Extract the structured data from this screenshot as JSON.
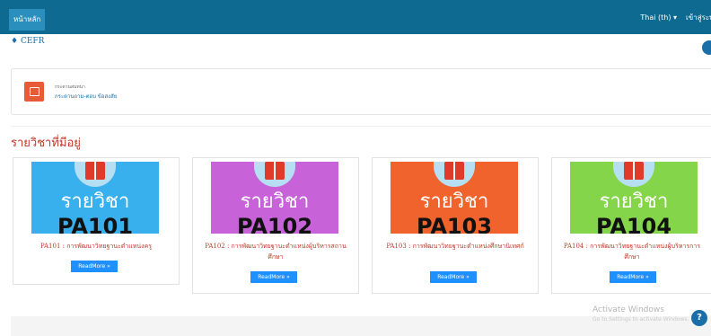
{
  "topbar": {
    "home_label": "หน้าหลัก",
    "language": "Thai (th) ▾",
    "login": "เข้าสู่ระบบ"
  },
  "site": {
    "cefr_label": "CEFR"
  },
  "category": {
    "label": "กระดานสนทนา",
    "link": "กระดานถาม-ตอบ ข้อสงสัย"
  },
  "section_title": "รายวิชาที่มีอยู่",
  "courses": [
    {
      "thumb_top": "รายวิชา",
      "thumb_code": "PA101",
      "title": "PA101 : การพัฒนาวิทยฐานะตำแหน่งครู",
      "button": "ReadMore »",
      "color": "#39b0ee"
    },
    {
      "thumb_top": "รายวิชา",
      "thumb_code": "PA102",
      "title": "PA102 : การพัฒนาวิทยฐานะตำแหน่งผู้บริหารสถานศึกษา",
      "button": "ReadMore »",
      "color": "#c862d8"
    },
    {
      "thumb_top": "รายวิชา",
      "thumb_code": "PA103",
      "title": "PA103 : การพัฒนาวิทยฐานะตำแหน่งศึกษานิเทศก์",
      "button": "ReadMore »",
      "color": "#f0632c"
    },
    {
      "thumb_top": "รายวิชา",
      "thumb_code": "PA104",
      "title": "PA104 : การพัฒนาวิทยฐานะตำแหน่งผู้บริหารการศึกษา",
      "button": "ReadMore »",
      "color": "#84d54a"
    }
  ],
  "watermark": {
    "title": "Activate Windows",
    "subtitle": "Go to Settings to activate Windows."
  },
  "help": {
    "label": "?"
  }
}
